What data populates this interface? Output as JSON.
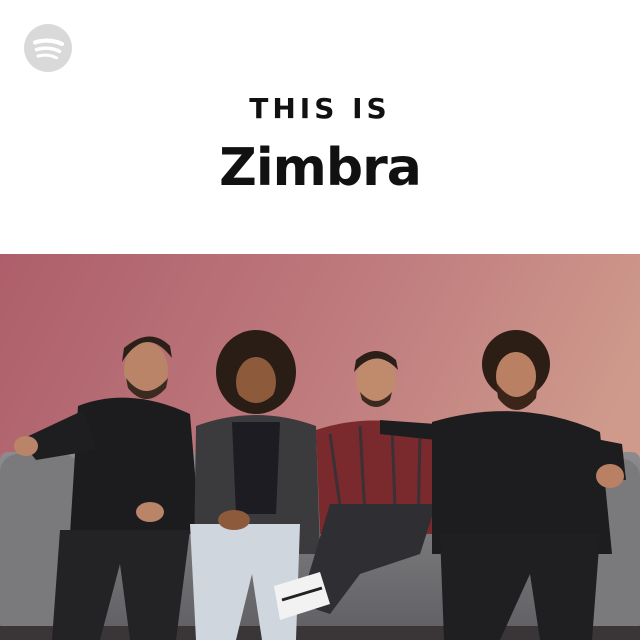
{
  "cover": {
    "kicker": "THIS IS",
    "artist": "Zimbra",
    "logo_icon": "spotify-logo-icon",
    "photo_description_icon": "band-photo",
    "colors": {
      "header_bg": "#ffffff",
      "photo_bg_left": "#b0646e",
      "photo_bg_right": "#c88f86",
      "logo_gray": "#d9d9d9"
    }
  }
}
